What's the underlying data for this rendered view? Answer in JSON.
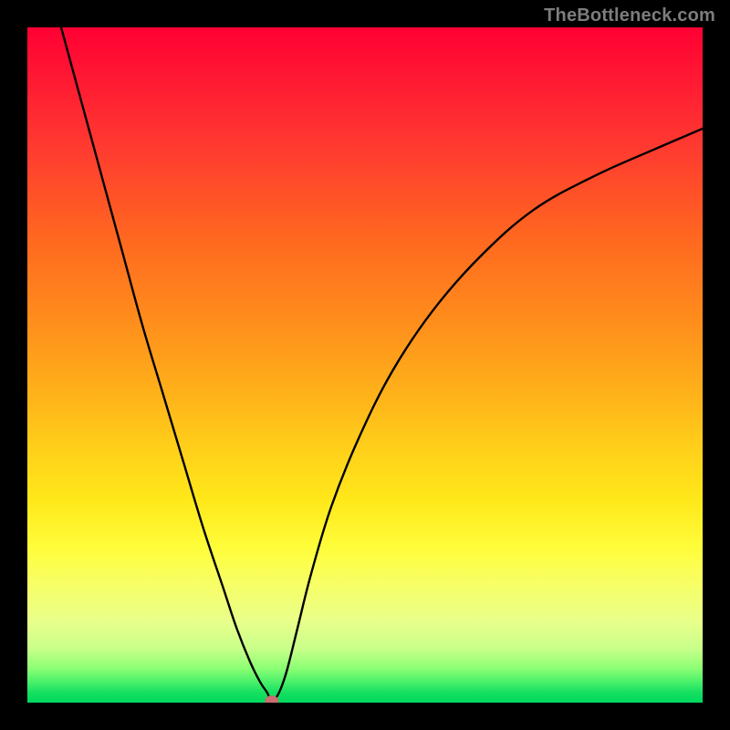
{
  "watermark": "TheBottleneck.com",
  "chart_data": {
    "type": "line",
    "title": "",
    "xlabel": "",
    "ylabel": "",
    "xlim": [
      0,
      100
    ],
    "ylim": [
      0,
      100
    ],
    "grid": false,
    "legend": false,
    "background_gradient": {
      "direction": "top-to-bottom",
      "stops": [
        {
          "pos": 0.0,
          "color": "#ff0033"
        },
        {
          "pos": 0.3,
          "color": "#ff6a1f"
        },
        {
          "pos": 0.6,
          "color": "#ffd21a"
        },
        {
          "pos": 0.8,
          "color": "#fffd3a"
        },
        {
          "pos": 0.95,
          "color": "#8aff74"
        },
        {
          "pos": 1.0,
          "color": "#00d860"
        }
      ]
    },
    "series": [
      {
        "name": "bottleneck-curve",
        "color": "#000000",
        "x": [
          5.0,
          8.0,
          11.0,
          14.0,
          17.0,
          20.0,
          23.0,
          26.0,
          29.0,
          31.0,
          33.0,
          34.5,
          35.5,
          36.0,
          36.7,
          37.5,
          38.5,
          40.0,
          42.0,
          45.0,
          49.0,
          54.0,
          60.0,
          67.0,
          75.0,
          84.0,
          93.0,
          100.0
        ],
        "y": [
          100.0,
          89.0,
          78.0,
          67.0,
          56.0,
          46.0,
          36.0,
          26.0,
          17.0,
          11.0,
          6.0,
          3.0,
          1.5,
          0.5,
          0.6,
          2.0,
          5.0,
          11.0,
          19.0,
          29.0,
          39.0,
          49.0,
          58.0,
          66.0,
          73.0,
          78.0,
          82.0,
          85.0
        ]
      }
    ],
    "marker": {
      "x": 36.2,
      "y": 0.3,
      "color": "#cc6f72"
    }
  }
}
